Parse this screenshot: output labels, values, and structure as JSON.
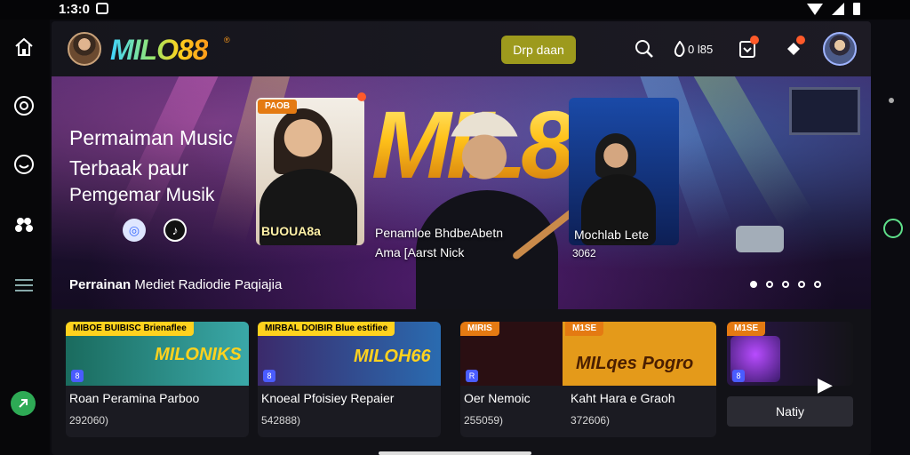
{
  "status_bar": {
    "time": "1:3:0"
  },
  "app": {
    "logo_text": "MILO88",
    "logo_mark": "®",
    "cta_label": "Drp daan",
    "coins_label": "0 l85"
  },
  "nav_rail": {
    "items": [
      {
        "name": "home",
        "icon": "home-icon"
      },
      {
        "name": "music",
        "icon": "vinyl-icon"
      },
      {
        "name": "mood",
        "icon": "smile-icon"
      },
      {
        "name": "community",
        "icon": "cluster-icon"
      },
      {
        "name": "menu",
        "icon": "menu-icon"
      }
    ],
    "action_icon": "arrow-up-right-icon"
  },
  "hero": {
    "title": "Permaiman Music Terbaak paur",
    "subtitle": "Pemgemar Musik",
    "caption_bold": "Perrainan",
    "caption_rest": "Mediet Radiodie Paqiajia",
    "big_logo": "MIL88",
    "cards": [
      {
        "tag": "PAOB",
        "title": "BUOUA8a"
      },
      {
        "title": "Mochlab Lete",
        "count": "3062"
      }
    ],
    "center_title": "Penamloe BhdbeAbetn",
    "center_sub": "Ama [Aarst Nick",
    "slide_count": 5,
    "active_slide": 1
  },
  "tiles": [
    {
      "tag": "MIBOE BUIBISC Brienaflee",
      "title": "Roan Peramina Parboo",
      "count": "292060)",
      "badge": "8"
    },
    {
      "tag": "MIRBAL DOIBIR Blue estifiee",
      "title": "Knoeal Pfoisiey Repaier",
      "count": "542888)",
      "badge": "8"
    },
    {
      "tag": "MIRIS",
      "title": "Oer Nemoic",
      "count": "255059)",
      "badge": "R"
    },
    {
      "tag": "M1SE",
      "title": "Kaht Hara e Graoh",
      "count": "372606)",
      "art_text": "MILqes Pogro"
    },
    {
      "tag": "M1SE",
      "badge": "8"
    }
  ],
  "tile_art": [
    "MILONIKS",
    "MILOH66",
    "MILqes Pogro"
  ],
  "notify_label": "Natiy",
  "colors": {
    "accent_yellow": "#ffd21e",
    "accent_orange": "#e47a12",
    "cta_olive": "#9d9a1d"
  }
}
